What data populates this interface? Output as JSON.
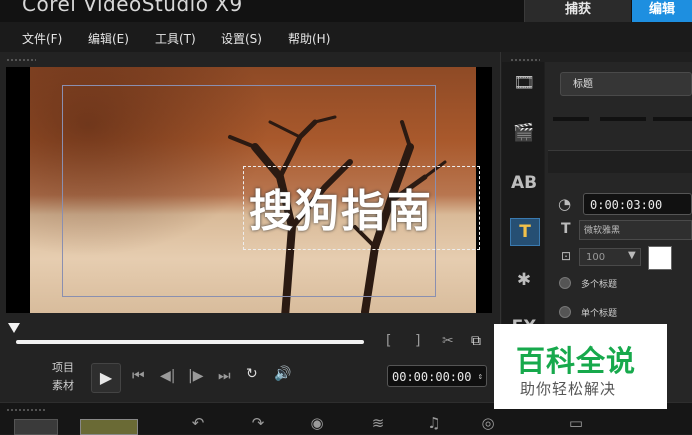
{
  "app": {
    "title": "Corel VideoStudio X9"
  },
  "tabs": {
    "capture": "捕获",
    "edit": "编辑"
  },
  "menu": [
    "文件(F)",
    "编辑(E)",
    "工具(T)",
    "设置(S)",
    "帮助(H)"
  ],
  "preview": {
    "title_text": "搜狗指南",
    "mode_project": "项目",
    "mode_clip": "素材",
    "timecode": "00:00:00:00",
    "scrubber_position": 0
  },
  "options_panel": {
    "library_dropdown": "标题",
    "duration": "0:00:03:00",
    "font_name": "微软雅黑",
    "font_size": "100",
    "text_color": "#ffffff",
    "radio_multi": "多个标题",
    "radio_single": "单个标题"
  },
  "watermark": {
    "logo": "百科全说",
    "sub": "助你轻松解决"
  },
  "colors": {
    "accent": "#1e8fe0",
    "watermark_green": "#17a94c"
  }
}
